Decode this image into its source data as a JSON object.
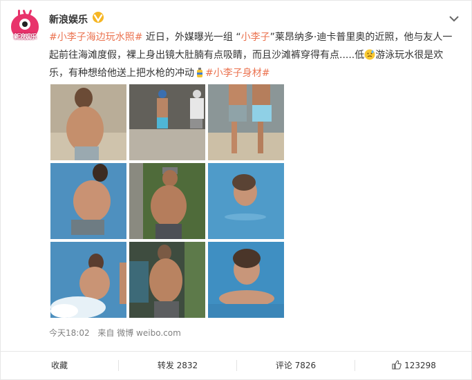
{
  "post": {
    "username": "新浪娱乐",
    "avatar_text": "新浪娱乐",
    "text_parts": {
      "tag1": "#小李子海边玩水照#",
      "seg1": " 近日，外媒曝光一组 “",
      "name1": "小李子",
      "seg2": "”莱昂纳多·迪卡普里奥的近照，他与友人一起前往海滩度假，裸上身出镜大肚腩有点吸睛，而且沙滩裤穿得有点.....低",
      "seg3": "游泳玩水很是欢乐，有种想给他送上把水枪的冲动",
      "tag2": "#小李子身材#"
    },
    "time": "今天18:02",
    "source": "来自 微博 weibo.com"
  },
  "actions": {
    "favorite": "收藏",
    "repost": "转发 2832",
    "comment": "评论 7826",
    "like": "123298"
  },
  "colors": {
    "tag": "#eb7350",
    "verified": "#f6b624",
    "avatar": "#e8336b"
  },
  "icons": [
    "verified-icon",
    "chevron-down-icon",
    "embarrassed-emoji-icon",
    "bottle-emoji-icon",
    "thumbs-up-icon"
  ]
}
